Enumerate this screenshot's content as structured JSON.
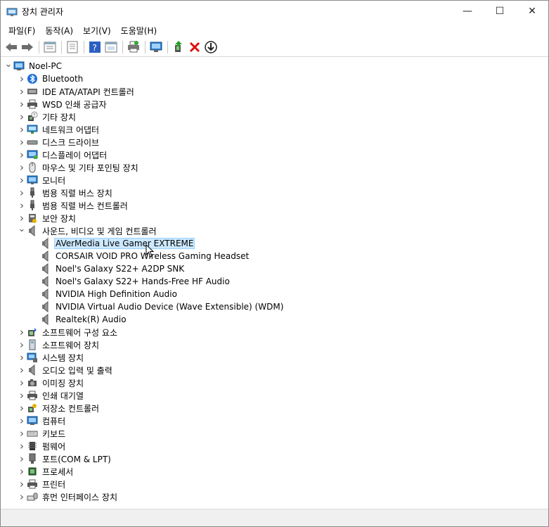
{
  "window": {
    "title": "장치 관리자"
  },
  "window_controls": {
    "minimize": "—",
    "maximize": "☐",
    "close": "✕"
  },
  "menu": [
    "파일(F)",
    "동작(A)",
    "보기(V)",
    "도움말(H)"
  ],
  "toolbar": [
    "back-icon",
    "forward-icon",
    "sep",
    "properties-icon",
    "sep",
    "view-icon",
    "sep",
    "help-icon",
    "details-icon",
    "sep",
    "print-icon",
    "sep",
    "monitor-scan-icon",
    "sep",
    "update-driver-icon",
    "uninstall-icon",
    "download-icon"
  ],
  "tree": {
    "root": "Noel-PC",
    "categories": [
      {
        "label": "Bluetooth",
        "icon": "bluetooth-icon",
        "expanded": false
      },
      {
        "label": "IDE ATA/ATAPI 컨트롤러",
        "icon": "ide-controller-icon",
        "expanded": false
      },
      {
        "label": "WSD 인쇄 공급자",
        "icon": "printer-icon",
        "expanded": false
      },
      {
        "label": "기타 장치",
        "icon": "unknown-device-icon",
        "expanded": false
      },
      {
        "label": "네트워크 어댑터",
        "icon": "network-icon",
        "expanded": false
      },
      {
        "label": "디스크 드라이브",
        "icon": "disk-icon",
        "expanded": false
      },
      {
        "label": "디스플레이 어댑터",
        "icon": "display-adapter-icon",
        "expanded": false
      },
      {
        "label": "마우스 및 기타 포인팅 장치",
        "icon": "mouse-icon",
        "expanded": false
      },
      {
        "label": "모니터",
        "icon": "monitor-icon",
        "expanded": false
      },
      {
        "label": "범용 직렬 버스 장치",
        "icon": "usb-icon",
        "expanded": false
      },
      {
        "label": "범용 직렬 버스 컨트롤러",
        "icon": "usb-icon",
        "expanded": false
      },
      {
        "label": "보안 장치",
        "icon": "security-icon",
        "expanded": false
      },
      {
        "label": "사운드, 비디오 및 게임 컨트롤러",
        "icon": "speaker-icon",
        "expanded": true,
        "children": [
          "AVerMedia Live Gamer EXTREME",
          "CORSAIR VOID PRO Wireless Gaming Headset",
          "Noel's Galaxy S22+ A2DP SNK",
          "Noel's Galaxy S22+ Hands-Free HF Audio",
          "NVIDIA High Definition Audio",
          "NVIDIA Virtual Audio Device (Wave Extensible) (WDM)",
          "Realtek(R) Audio"
        ]
      },
      {
        "label": "소프트웨어 구성 요소",
        "icon": "software-component-icon",
        "expanded": false
      },
      {
        "label": "소프트웨어 장치",
        "icon": "software-device-icon",
        "expanded": false
      },
      {
        "label": "시스템 장치",
        "icon": "system-icon",
        "expanded": false
      },
      {
        "label": "오디오 입력 및 출력",
        "icon": "speaker-icon",
        "expanded": false
      },
      {
        "label": "이미징 장치",
        "icon": "camera-icon",
        "expanded": false
      },
      {
        "label": "인쇄 대기열",
        "icon": "printer-icon",
        "expanded": false
      },
      {
        "label": "저장소 컨트롤러",
        "icon": "storage-controller-icon",
        "expanded": false
      },
      {
        "label": "컴퓨터",
        "icon": "computer-icon",
        "expanded": false
      },
      {
        "label": "키보드",
        "icon": "keyboard-icon",
        "expanded": false
      },
      {
        "label": "펌웨어",
        "icon": "firmware-icon",
        "expanded": false
      },
      {
        "label": "포트(COM & LPT)",
        "icon": "port-icon",
        "expanded": false
      },
      {
        "label": "프로세서",
        "icon": "processor-icon",
        "expanded": false
      },
      {
        "label": "프린터",
        "icon": "printer-icon",
        "expanded": false
      },
      {
        "label": "휴먼 인터페이스 장치",
        "icon": "hid-icon",
        "expanded": false
      }
    ],
    "selected": "AVerMedia Live Gamer EXTREME"
  }
}
